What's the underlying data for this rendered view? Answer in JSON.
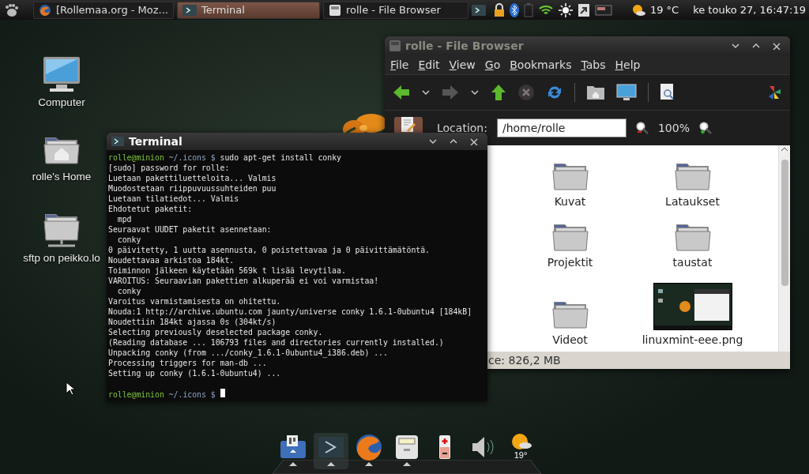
{
  "top_panel": {
    "tasks": [
      {
        "kind": "browser",
        "label": "[Rollemaa.org - Moz...",
        "selected": false
      },
      {
        "kind": "terminal",
        "label": "Terminal",
        "selected": true
      },
      {
        "kind": "files",
        "label": "rolle - File Browser",
        "selected": false
      }
    ],
    "weather": "19 °C",
    "clock": "ke touko 27, 16:47:19"
  },
  "desktop_icons": [
    {
      "kind": "computer",
      "label": "Computer"
    },
    {
      "kind": "home",
      "label": "rolle's Home"
    },
    {
      "kind": "network",
      "label": "sftp on peikko.lo"
    }
  ],
  "file_browser": {
    "title": "rolle - File Browser",
    "menu": [
      "File",
      "Edit",
      "View",
      "Go",
      "Bookmarks",
      "Tabs",
      "Help"
    ],
    "location_label": "Location:",
    "location": "/home/rolle",
    "zoom": "100%",
    "items": [
      {
        "kind": "folder",
        "label": "Kuvat"
      },
      {
        "kind": "folder",
        "label": "Lataukset"
      },
      {
        "kind": "folder",
        "label": "Projektit"
      },
      {
        "kind": "folder",
        "label": "taustat"
      },
      {
        "kind": "folder",
        "label": "Videot"
      },
      {
        "label": "linuxmint-eee.png"
      }
    ],
    "status": "ce: 826,2 MB"
  },
  "terminal": {
    "title": "Terminal",
    "lines": [
      {
        "kind": "prompt",
        "user": "rolle@minion",
        "path": "~/.icons $",
        "command": "sudo apt-get install conky"
      },
      {
        "kind": "output",
        "text": "[sudo] password for rolle:"
      },
      {
        "kind": "output",
        "text": "Luetaan pakettiluetteloita... Valmis"
      },
      {
        "kind": "output",
        "text": "Muodostetaan riippuvuussuhteiden puu"
      },
      {
        "kind": "output",
        "text": "Luetaan tilatiedot... Valmis"
      },
      {
        "kind": "output",
        "text": "Ehdotetut paketit:"
      },
      {
        "kind": "output",
        "text": "  mpd"
      },
      {
        "kind": "output",
        "text": "Seuraavat UUDET paketit asennetaan:"
      },
      {
        "kind": "output",
        "text": "  conky"
      },
      {
        "kind": "output",
        "text": "0 päivitetty, 1 uutta asennusta, 0 poistettavaa ja 0 päivittämätöntä."
      },
      {
        "kind": "output",
        "text": "Noudettavaa arkistoa 184kt."
      },
      {
        "kind": "output",
        "text": "Toiminnon jälkeen käytetään 569k t lisää levytilaa."
      },
      {
        "kind": "output",
        "text": "VAROITUS: Seuraavian pakettien alkuperää ei voi varmistaa!"
      },
      {
        "kind": "output",
        "text": "  conky"
      },
      {
        "kind": "output",
        "text": "Varoitus varmistamisesta on ohitettu."
      },
      {
        "kind": "output",
        "text": "Nouda:1 http://archive.ubuntu.com jaunty/universe conky 1.6.1-0ubuntu4 [184kB]"
      },
      {
        "kind": "output",
        "text": "Noudettiin 184kt ajassa 0s (304kt/s)"
      },
      {
        "kind": "output",
        "text": "Selecting previously deselected package conky."
      },
      {
        "kind": "output",
        "text": "(Reading database ... 106793 files and directories currently installed.)"
      },
      {
        "kind": "output",
        "text": "Unpacking conky (from .../conky_1.6.1-0ubuntu4_i386.deb) ..."
      },
      {
        "kind": "output",
        "text": "Processing triggers for man-db ..."
      },
      {
        "kind": "output",
        "text": "Setting up conky (1.6.1-0ubuntu4) ..."
      },
      {
        "kind": "blank"
      },
      {
        "kind": "prompt",
        "user": "rolle@minion",
        "path": "~/.icons $",
        "cursor": true
      }
    ]
  },
  "dock": {
    "items": [
      {
        "kind": "display",
        "running": true,
        "selected": false
      },
      {
        "kind": "terminal",
        "running": true,
        "selected": true
      },
      {
        "kind": "browser",
        "running": true,
        "selected": false
      },
      {
        "kind": "files",
        "running": true,
        "selected": false
      },
      {
        "kind": "battery",
        "running": false,
        "selected": false
      },
      {
        "kind": "volume",
        "running": false,
        "selected": false
      },
      {
        "kind": "weather",
        "running": false,
        "selected": false,
        "label": "19°"
      }
    ]
  }
}
